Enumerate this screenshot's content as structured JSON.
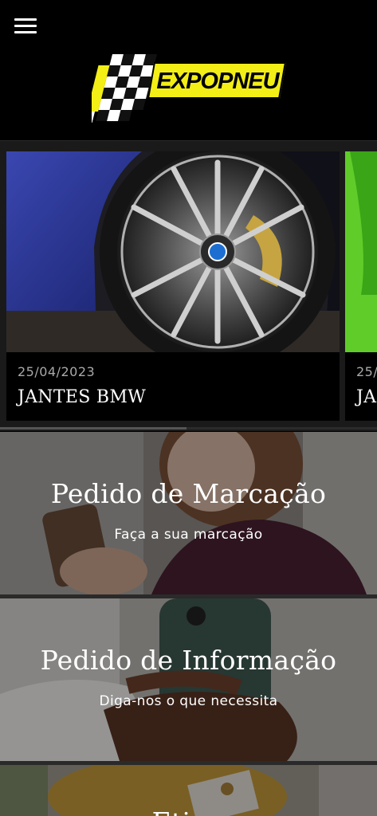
{
  "header": {
    "menu_icon": "hamburger-menu-icon",
    "logo_text": "EXPOPNEU",
    "logo_color": "#f3ee16"
  },
  "carousel": {
    "cards": [
      {
        "date": "25/04/2023",
        "title": "JANTES BMW"
      },
      {
        "date": "25/",
        "title": "JA"
      }
    ]
  },
  "banners": [
    {
      "title": "Pedido de Marcação",
      "subtitle": "Faça a sua marcação"
    },
    {
      "title": "Pedido de Informação",
      "subtitle": "Diga-nos o que necessita"
    },
    {
      "title": "Etiqu"
    }
  ]
}
